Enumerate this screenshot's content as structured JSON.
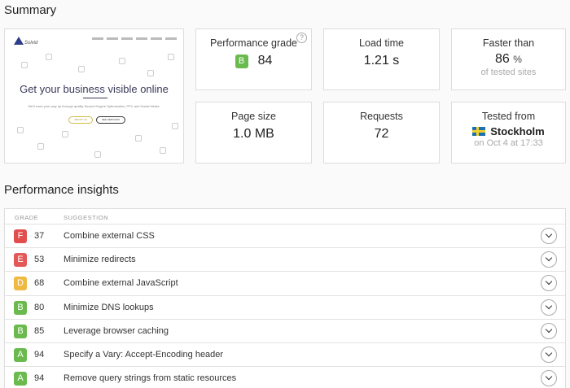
{
  "summary": {
    "title": "Summary",
    "thumbnail": {
      "headline": "Get your business visible online",
      "subline": "We'll work your way up through quality Search Engine Optimization, PPC and Social Media.",
      "button1": "ABOUT US",
      "button2": "SEE SERVICES",
      "logo": "Solvid"
    },
    "cards": {
      "grade": {
        "label": "Performance grade",
        "letter": "B",
        "value": "84",
        "help": "?"
      },
      "load": {
        "label": "Load time",
        "value": "1.21 s"
      },
      "faster": {
        "label": "Faster than",
        "value": "86",
        "unit": "%",
        "sub": "of tested sites"
      },
      "size": {
        "label": "Page size",
        "value": "1.0 MB"
      },
      "requests": {
        "label": "Requests",
        "value": "72"
      },
      "tested": {
        "label": "Tested from",
        "city": "Stockholm",
        "sub": "on Oct 4 at 17:33"
      }
    }
  },
  "insights": {
    "title": "Performance insights",
    "headers": {
      "grade": "GRADE",
      "suggestion": "SUGGESTION"
    },
    "rows": [
      {
        "grade": "F",
        "score": "37",
        "text": "Combine external CSS"
      },
      {
        "grade": "E",
        "score": "53",
        "text": "Minimize redirects"
      },
      {
        "grade": "D",
        "score": "68",
        "text": "Combine external JavaScript"
      },
      {
        "grade": "B",
        "score": "80",
        "text": "Minimize DNS lookups"
      },
      {
        "grade": "B",
        "score": "85",
        "text": "Leverage browser caching"
      },
      {
        "grade": "A",
        "score": "94",
        "text": "Specify a Vary: Accept-Encoding header"
      },
      {
        "grade": "A",
        "score": "94",
        "text": "Remove query strings from static resources"
      }
    ]
  },
  "colors": {
    "grade_a": "#6aba4e",
    "grade_b": "#6aba4e",
    "grade_d": "#f0b942",
    "grade_e": "#e45858",
    "grade_f": "#e24e4e"
  }
}
